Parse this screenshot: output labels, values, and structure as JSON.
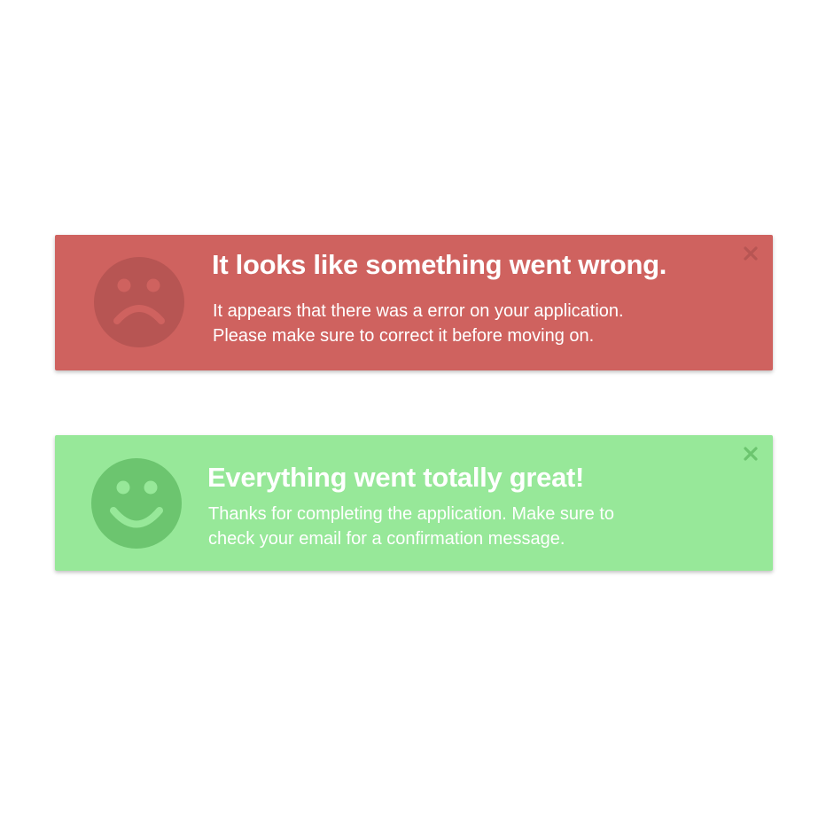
{
  "alerts": {
    "error": {
      "title": "It looks like something went wrong.",
      "line1": "It appears that there was a error on your application.",
      "line2": "Please make sure to correct it before moving on.",
      "icon": "sad-face-icon",
      "close_icon": "close-icon",
      "background": "#cf625f",
      "accent": "#b75553"
    },
    "success": {
      "title": "Everything went totally great!",
      "line1": "Thanks for completing the application. Make sure to",
      "line2": "check your email for a confirmation message.",
      "icon": "happy-face-icon",
      "close_icon": "close-icon",
      "background": "#97e899",
      "accent": "#6cc56f"
    }
  }
}
